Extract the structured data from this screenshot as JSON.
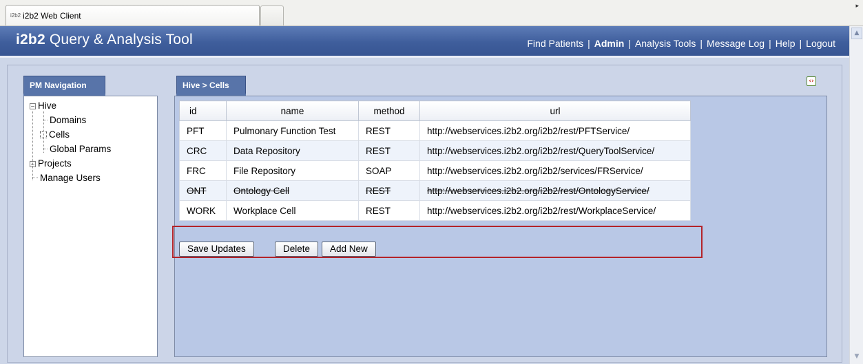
{
  "browser": {
    "tab_title": "i2b2 Web Client",
    "tab_favicon": "i2b2"
  },
  "header": {
    "logo_brand": "i2b2",
    "logo_title": "Query & Analysis Tool",
    "nav": [
      {
        "label": "Find Patients",
        "active": false
      },
      {
        "label": "Admin",
        "active": true
      },
      {
        "label": "Analysis Tools",
        "active": false
      },
      {
        "label": "Message Log",
        "active": false
      },
      {
        "label": "Help",
        "active": false
      },
      {
        "label": "Logout",
        "active": false
      }
    ]
  },
  "pm_nav": {
    "tab_label": "PM Navigation",
    "tree": {
      "hive": "Hive",
      "domains": "Domains",
      "cells": "Cells",
      "global_params": "Global Params",
      "projects": "Projects",
      "manage_users": "Manage Users"
    }
  },
  "hive_cells": {
    "tab_label": "Hive > Cells",
    "columns": {
      "id": "id",
      "name": "name",
      "method": "method",
      "url": "url"
    },
    "rows": [
      {
        "id": "PFT",
        "name": "Pulmonary Function Test",
        "method": "REST",
        "url": "http://webservices.i2b2.org/i2b2/rest/PFTService/"
      },
      {
        "id": "CRC",
        "name": "Data Repository",
        "method": "REST",
        "url": "http://webservices.i2b2.org/i2b2/rest/QueryToolService/"
      },
      {
        "id": "FRC",
        "name": "File Repository",
        "method": "SOAP",
        "url": "http://webservices.i2b2.org/i2b2/services/FRService/"
      },
      {
        "id": "ONT",
        "name": "Ontology Cell",
        "method": "REST",
        "url": "http://webservices.i2b2.org/i2b2/rest/OntologyService/"
      },
      {
        "id": "WORK",
        "name": "Workplace Cell",
        "method": "REST",
        "url": "http://webservices.i2b2.org/i2b2/rest/WorkplaceService/"
      }
    ],
    "buttons": {
      "save": "Save Updates",
      "delete": "Delete",
      "add": "Add New"
    }
  },
  "colors": {
    "header_blue": "#3f5e9c",
    "panel_tab": "#5874a9",
    "highlight": "#b42329",
    "content_bg": "#ccd5e8"
  },
  "icons": {
    "refresh": "refresh-icon",
    "tree_expand": "minus-expander-icon"
  }
}
